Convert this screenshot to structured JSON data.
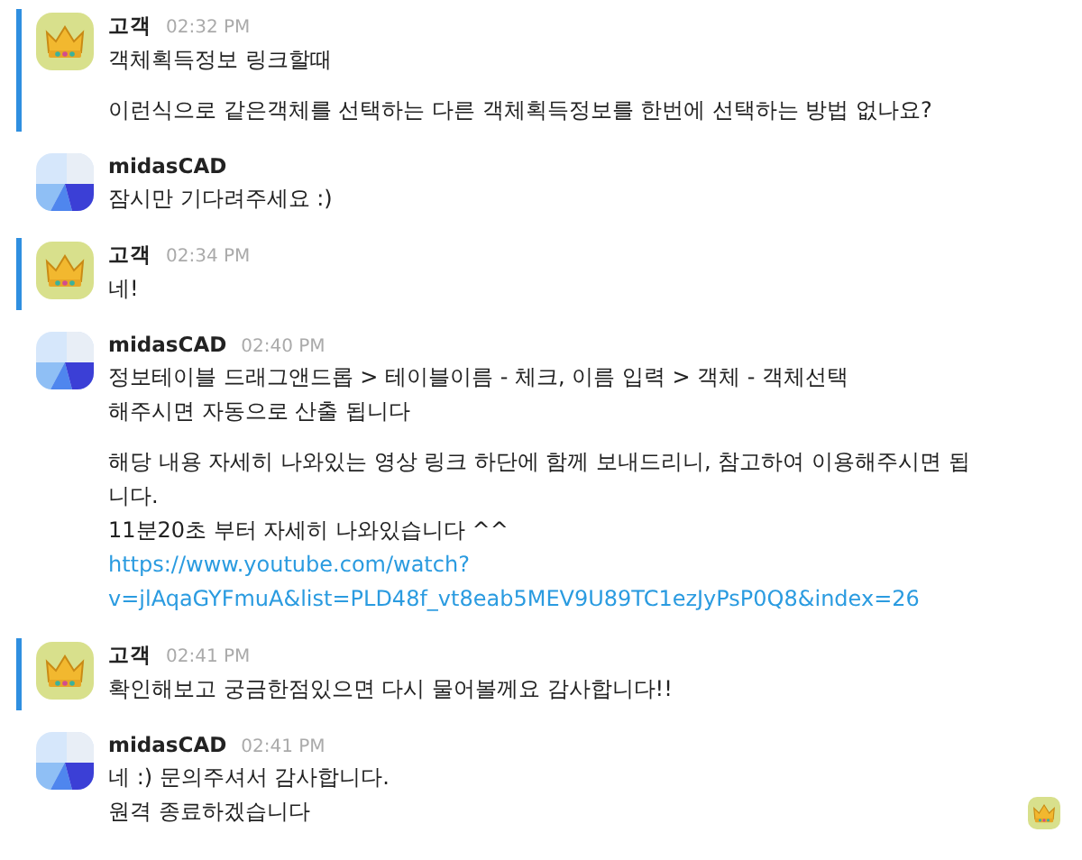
{
  "messages": [
    {
      "kind": "customer",
      "marked": true,
      "name": "고객",
      "time": "02:32 PM",
      "blocks": [
        [
          {
            "kind": "text",
            "text": "객체획득정보 링크할때"
          }
        ],
        [
          {
            "kind": "text",
            "text": "이런식으로 같은객체를 선택하는 다른 객체획득정보를 한번에 선택하는 방법 없나요?"
          }
        ]
      ]
    },
    {
      "kind": "agent",
      "marked": false,
      "name": "midasCAD",
      "blocks": [
        [
          {
            "kind": "text",
            "text": "잠시만 기다려주세요 :)"
          }
        ]
      ]
    },
    {
      "kind": "customer",
      "marked": true,
      "name": "고객",
      "time": "02:34 PM",
      "blocks": [
        [
          {
            "kind": "text",
            "text": "네!"
          }
        ]
      ]
    },
    {
      "kind": "agent",
      "marked": false,
      "name": "midasCAD",
      "time": "02:40 PM",
      "blocks": [
        [
          {
            "kind": "text",
            "text": "정보테이블 드래그앤드롭 > 테이블이름 - 체크, 이름 입력 > 객체 - 객체선택"
          },
          {
            "kind": "text",
            "text": "해주시면 자동으로 산출 됩니다"
          }
        ],
        [
          {
            "kind": "text",
            "text": "해당 내용 자세히 나와있는 영상 링크 하단에 함께 보내드리니, 참고하여 이용해주시면 됩"
          },
          {
            "kind": "text",
            "text": "니다."
          },
          {
            "kind": "text",
            "text": "11분20초 부터 자세히 나와있습니다 ^^"
          },
          {
            "kind": "link",
            "text": "https://www.youtube.com/watch?"
          },
          {
            "kind": "link",
            "text": "v=jlAqaGYFmuA&list=PLD48f_vt8eab5MEV9U89TC1ezJyPsP0Q8&index=26"
          }
        ]
      ]
    },
    {
      "kind": "customer",
      "marked": true,
      "name": "고객",
      "time": "02:41 PM",
      "blocks": [
        [
          {
            "kind": "text",
            "text": "확인해보고 궁금한점있으면 다시 물어볼께요 감사합니다!!"
          }
        ]
      ]
    },
    {
      "kind": "agent",
      "marked": false,
      "name": "midasCAD",
      "time": "02:41 PM",
      "seen": true,
      "blocks": [
        [
          {
            "kind": "text",
            "text": "네 :) 문의주셔서 감사합니다."
          },
          {
            "kind": "text",
            "text": "원격 종료하겠습니다"
          }
        ]
      ]
    }
  ]
}
